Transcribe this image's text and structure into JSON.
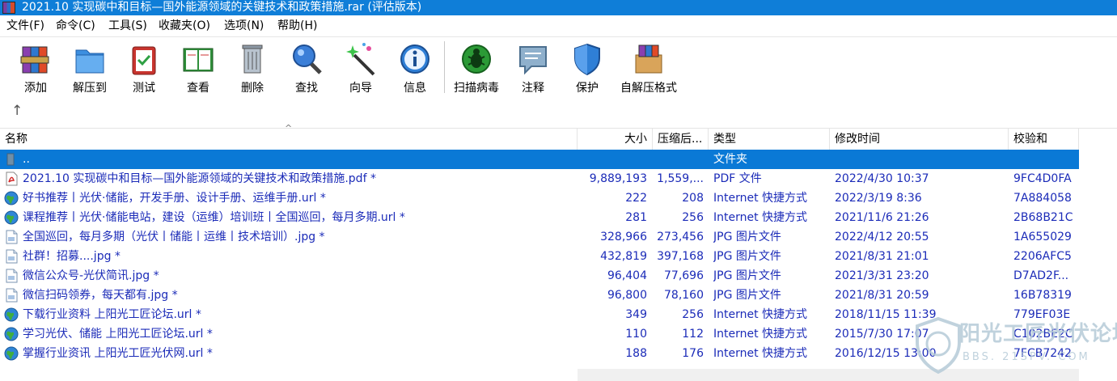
{
  "window": {
    "title": "2021.10 实现碳中和目标—国外能源领域的关键技术和政策措施.rar (评估版本)"
  },
  "menu": [
    "文件(F)",
    "命令(C)",
    "工具(S)",
    "收藏夹(O)",
    "选项(N)",
    "帮助(H)"
  ],
  "toolbar": {
    "add": "添加",
    "extract_to": "解压到",
    "test": "测试",
    "view": "查看",
    "delete": "删除",
    "find": "查找",
    "wizard": "向导",
    "info": "信息",
    "virus_scan": "扫描病毒",
    "comment": "注释",
    "protect": "保护",
    "sfx": "自解压格式",
    "up_arrow": "↑"
  },
  "columns": {
    "name": "名称",
    "size": "大小",
    "packed": "压缩后...",
    "type": "类型",
    "modified": "修改时间",
    "crc": "校验和"
  },
  "rows": [
    {
      "icon": "folder-up-icon",
      "name": "..",
      "size": "",
      "packed": "",
      "type": "文件夹",
      "modified": "",
      "crc": "",
      "selected": true
    },
    {
      "icon": "pdf-file-icon",
      "name": "2021.10 实现碳中和目标—国外能源领域的关键技术和政策措施.pdf *",
      "size": "9,889,193",
      "packed": "1,559,...",
      "type": "PDF 文件",
      "modified": "2022/4/30 10:37",
      "crc": "9FC4D0FA"
    },
    {
      "icon": "internet-shortcut-icon",
      "name": "好书推荐丨光伏·储能，开发手册、设计手册、运维手册.url *",
      "size": "222",
      "packed": "208",
      "type": "Internet 快捷方式",
      "modified": "2022/3/19 8:36",
      "crc": "7A884058"
    },
    {
      "icon": "internet-shortcut-icon",
      "name": "课程推荐丨光伏·储能电站，建设（运维）培训班丨全国巡回，每月多期.url *",
      "size": "281",
      "packed": "256",
      "type": "Internet 快捷方式",
      "modified": "2021/11/6 21:26",
      "crc": "2B68B21C"
    },
    {
      "icon": "image-file-icon",
      "name": "全国巡回，每月多期（光伏丨储能丨运维丨技术培训）.jpg *",
      "size": "328,966",
      "packed": "273,456",
      "type": "JPG 图片文件",
      "modified": "2022/4/12 20:55",
      "crc": "1A655029"
    },
    {
      "icon": "image-file-icon",
      "name": "社群！招募....jpg *",
      "size": "432,819",
      "packed": "397,168",
      "type": "JPG 图片文件",
      "modified": "2021/8/31 21:01",
      "crc": "2206AFC5"
    },
    {
      "icon": "image-file-icon",
      "name": "微信公众号-光伏简讯.jpg *",
      "size": "96,404",
      "packed": "77,696",
      "type": "JPG 图片文件",
      "modified": "2021/3/31 23:20",
      "crc": "D7AD2F..."
    },
    {
      "icon": "image-file-icon",
      "name": "微信扫码领券，每天都有.jpg *",
      "size": "96,800",
      "packed": "78,160",
      "type": "JPG 图片文件",
      "modified": "2021/8/31 20:59",
      "crc": "16B78319"
    },
    {
      "icon": "internet-shortcut-icon",
      "name": "下载行业资料 上阳光工匠论坛.url *",
      "size": "349",
      "packed": "256",
      "type": "Internet 快捷方式",
      "modified": "2018/11/15 11:39",
      "crc": "779EF03E"
    },
    {
      "icon": "internet-shortcut-icon",
      "name": "学习光伏、储能 上阳光工匠论坛.url *",
      "size": "110",
      "packed": "112",
      "type": "Internet 快捷方式",
      "modified": "2015/7/30 17:07",
      "crc": "C102BE2C"
    },
    {
      "icon": "internet-shortcut-icon",
      "name": "掌握行业资讯 上阳光工匠光伏网.url *",
      "size": "188",
      "packed": "176",
      "type": "Internet 快捷方式",
      "modified": "2016/12/15 13:00",
      "crc": "7FCB7242"
    }
  ],
  "watermark": {
    "text": "阳光工匠光伏论坛",
    "url": "BBS. 21SPV. COM"
  },
  "colors": {
    "titlebar": "#0f7ed8",
    "selection": "#0a79d6",
    "row_text": "#1b2bb8"
  }
}
